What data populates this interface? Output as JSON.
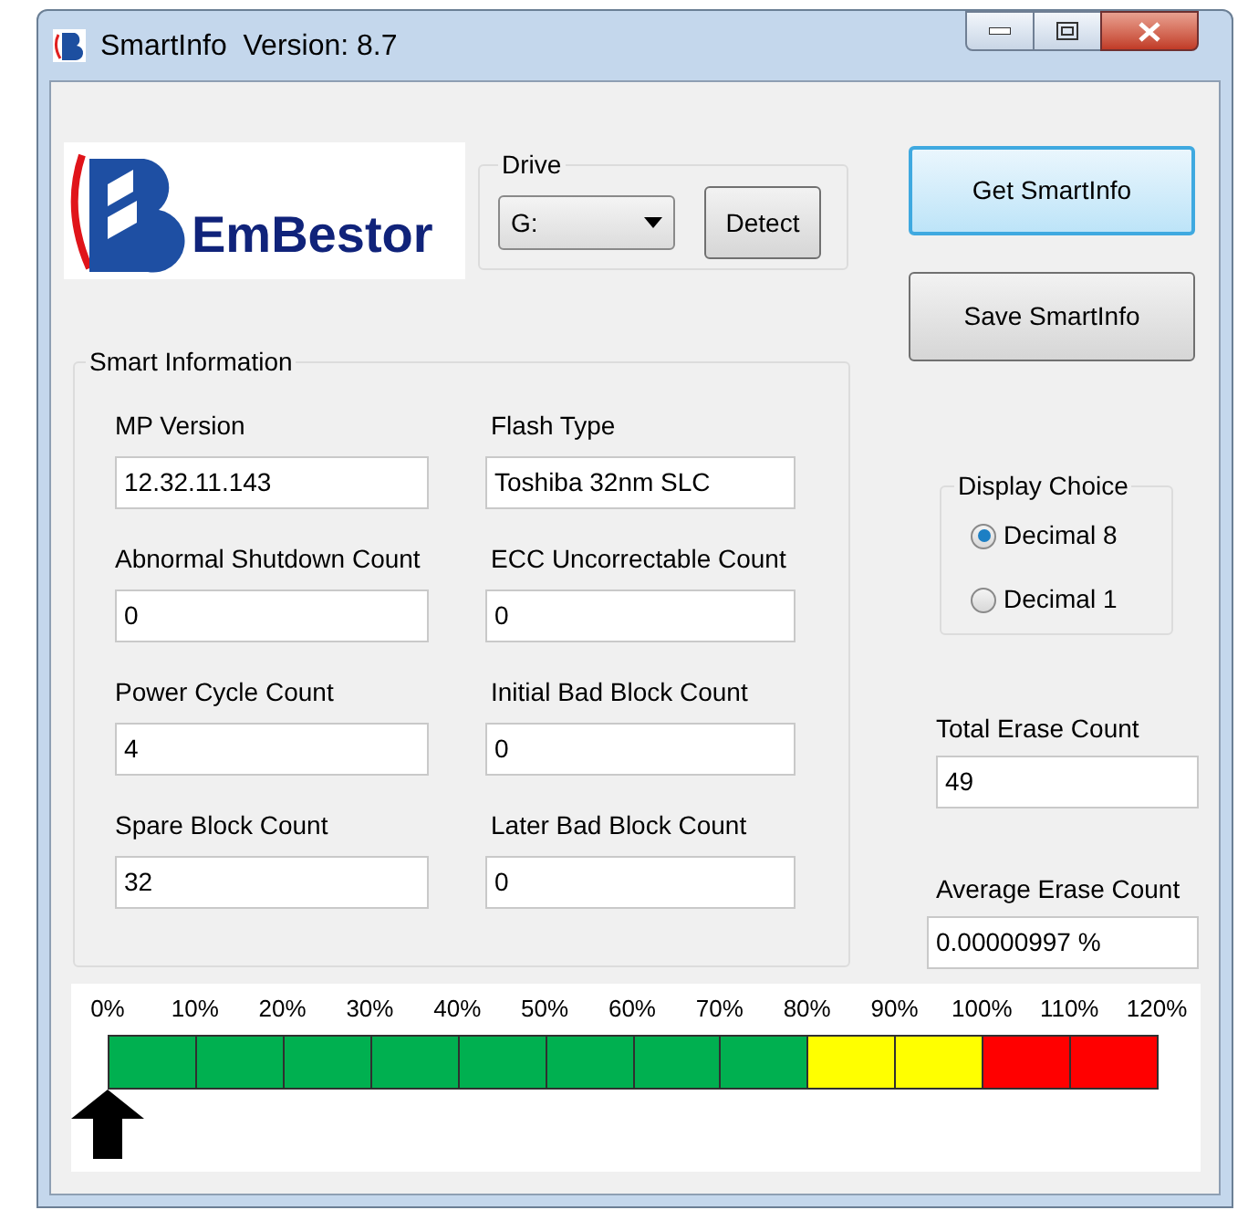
{
  "window": {
    "title": "SmartInfo  Version: 8.7"
  },
  "logo": {
    "text": "EmBestor"
  },
  "drive": {
    "legend": "Drive",
    "value": "G:",
    "detect_button": "Detect"
  },
  "buttons": [
    {
      "label": "Get SmartInfo",
      "focused": true
    },
    {
      "label": "Save SmartInfo",
      "focused": false
    }
  ],
  "smart_information": {
    "legend": "Smart Information",
    "fields": [
      {
        "label": "MP Version",
        "value": "12.32.11.143"
      },
      {
        "label": "Flash Type",
        "value": "Toshiba 32nm SLC"
      },
      {
        "label": "Abnormal Shutdown Count",
        "value": "0"
      },
      {
        "label": "ECC Uncorrectable Count",
        "value": "0"
      },
      {
        "label": "Power Cycle Count",
        "value": "4"
      },
      {
        "label": "Initial Bad Block Count",
        "value": "0"
      },
      {
        "label": "Spare Block Count",
        "value": "32"
      },
      {
        "label": "Later Bad Block Count",
        "value": "0"
      }
    ]
  },
  "display_choice": {
    "legend": "Display Choice",
    "options": [
      {
        "label": "Decimal 8",
        "selected": true
      },
      {
        "label": "Decimal 1",
        "selected": false
      }
    ]
  },
  "total_erase_count": {
    "label": "Total Erase Count",
    "value": "49"
  },
  "average_erase_count": {
    "label": "Average Erase Count",
    "value": "0.00000997 %"
  },
  "gauge": {
    "ticks": [
      "0%",
      "10%",
      "20%",
      "30%",
      "40%",
      "50%",
      "60%",
      "70%",
      "80%",
      "90%",
      "100%",
      "110%",
      "120%"
    ],
    "segments": [
      {
        "color": "#00b050"
      },
      {
        "color": "#00b050"
      },
      {
        "color": "#00b050"
      },
      {
        "color": "#00b050"
      },
      {
        "color": "#00b050"
      },
      {
        "color": "#00b050"
      },
      {
        "color": "#00b050"
      },
      {
        "color": "#00b050"
      },
      {
        "color": "#ffff00"
      },
      {
        "color": "#ffff00"
      },
      {
        "color": "#ff0000"
      },
      {
        "color": "#ff0000"
      }
    ],
    "level": 0
  }
}
